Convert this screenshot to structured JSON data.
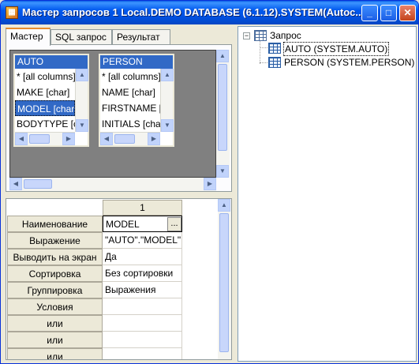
{
  "window": {
    "title": "Мастер запросов 1 Local.DEMO DATABASE (6.1.12).SYSTEM(Autoc...",
    "app_icon": "query-wizard-icon",
    "buttons": {
      "minimize": "_",
      "maximize": "□",
      "close": "✕"
    }
  },
  "tabs": [
    {
      "label": "Мастер",
      "active": true
    },
    {
      "label": "SQL запрос",
      "active": false
    },
    {
      "label": "Результат",
      "active": false
    }
  ],
  "tables": [
    {
      "name": "AUTO",
      "fields": [
        "* [all columns]",
        "MAKE [char]",
        "MODEL [char]",
        "BODYTYPE [char]"
      ],
      "selected_field": "MODEL [char]"
    },
    {
      "name": "PERSON",
      "fields": [
        "* [all columns]",
        "NAME [char]",
        "FIRSTNAME [char]",
        "INITIALS [char]"
      ],
      "selected_field": null
    }
  ],
  "grid": {
    "column_header": "1",
    "rows": [
      {
        "label": "Наименование",
        "value": "MODEL",
        "has_button": true,
        "button_label": "..."
      },
      {
        "label": "Выражение",
        "value": "\"AUTO\".\"MODEL\""
      },
      {
        "label": "Выводить на экран",
        "value": "Да"
      },
      {
        "label": "Сортировка",
        "value": "Без сортировки"
      },
      {
        "label": "Группировка",
        "value": "Выражения"
      },
      {
        "label": "Условия",
        "value": ""
      },
      {
        "label": "или",
        "value": ""
      },
      {
        "label": "или",
        "value": ""
      },
      {
        "label": "или",
        "value": ""
      },
      {
        "label": "или",
        "value": ""
      }
    ]
  },
  "tree": {
    "root": {
      "label": "Запрос",
      "expander": "−"
    },
    "children": [
      {
        "label": "AUTO (SYSTEM.AUTO)",
        "selected": true
      },
      {
        "label": "PERSON (SYSTEM.PERSON)",
        "selected": false
      }
    ]
  },
  "scroll_arrows": {
    "up": "▲",
    "down": "▼",
    "left": "◀",
    "right": "▶"
  }
}
